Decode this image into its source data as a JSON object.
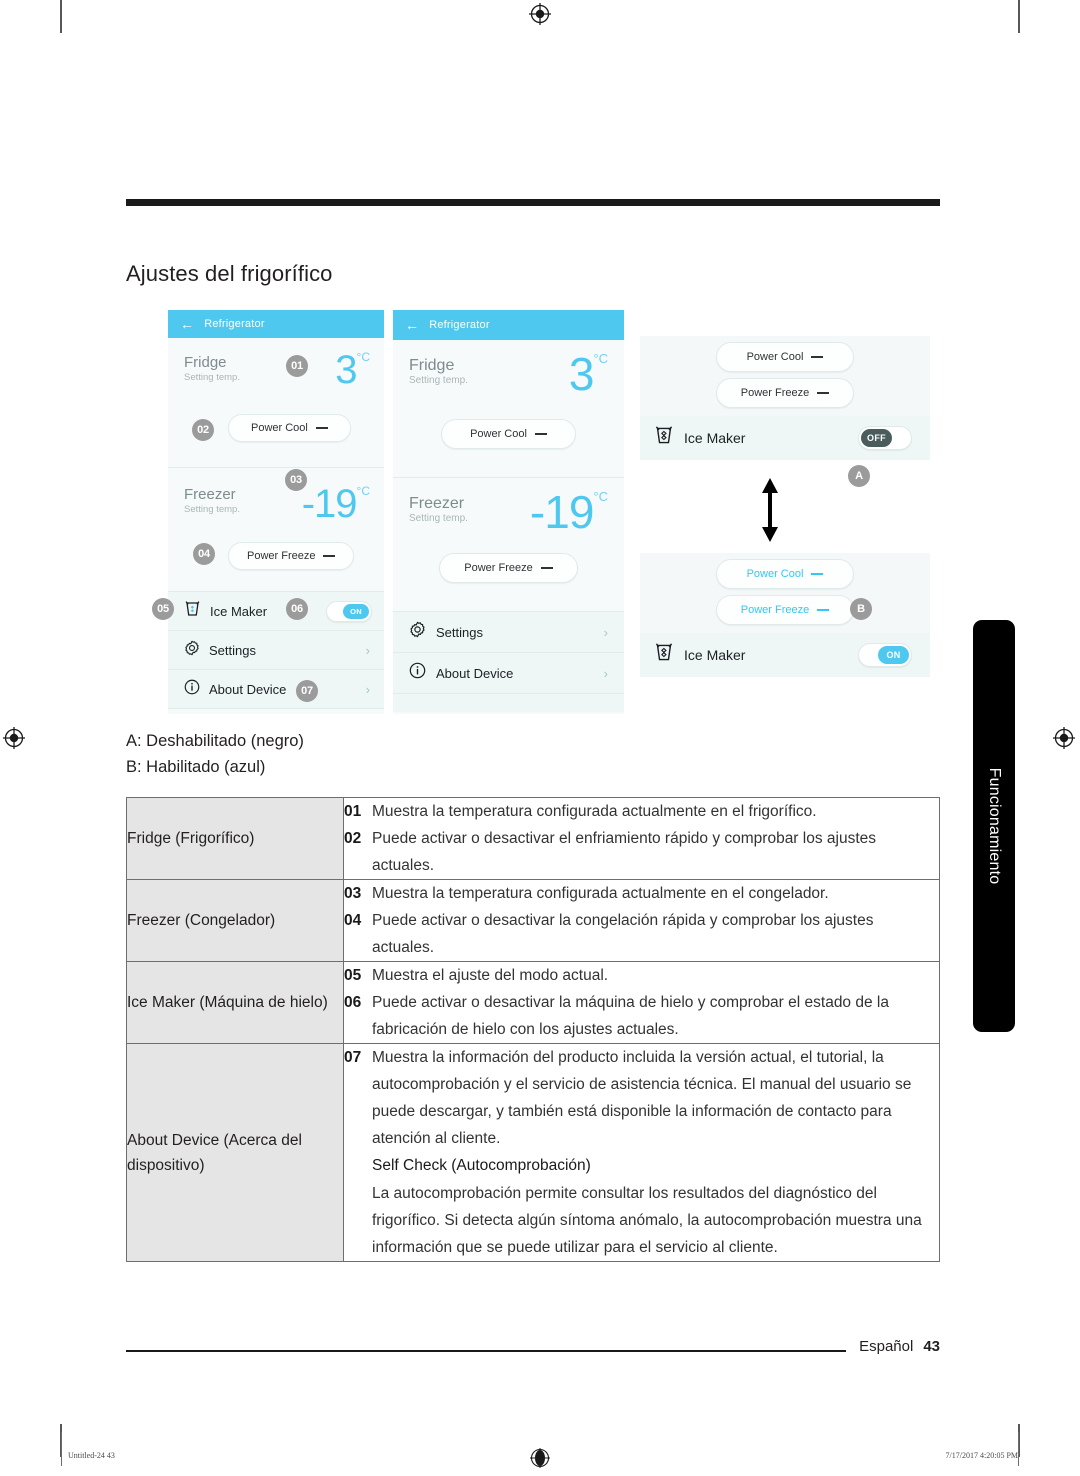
{
  "page": {
    "section_title": "Ajustes del frigorífico",
    "side_tab": "Funcionamiento",
    "footer_language": "Español",
    "footer_page": "43",
    "print_file": "Untitled-24   43",
    "print_timestamp": "7/17/2017   4:20:05 PM"
  },
  "legend": {
    "line_a": "A: Deshabilitado (negro)",
    "line_b": "B: Habilitado (azul)"
  },
  "colors": {
    "accent_blue": "#4fc8f0",
    "toggle_off": "#4b5c5c",
    "badge_gray": "#9b9b9b",
    "key_cell_bg": "#e5e5e5"
  },
  "screen1": {
    "titlebar": "Refrigerator",
    "back_icon": "back-arrow-icon",
    "fridge": {
      "label": "Fridge",
      "sublabel": "Setting temp.",
      "value": "3",
      "unit": "°C",
      "badge_value": "01",
      "button": {
        "label": "Power Cool",
        "badge": "02",
        "state": "off"
      }
    },
    "freezer": {
      "label": "Freezer",
      "sublabel": "Setting temp.",
      "value": "-19",
      "unit": "°C",
      "badge_value": "03",
      "button": {
        "label": "Power Freeze",
        "badge": "04",
        "state": "off"
      }
    },
    "ice_maker": {
      "label": "Ice Maker",
      "icon": "ice-maker-icon",
      "badge_left": "05",
      "badge_right": "06",
      "toggle": "ON"
    },
    "settings": {
      "label": "Settings",
      "icon": "gear-icon",
      "chevron": "›"
    },
    "about": {
      "label": "About Device",
      "icon": "info-icon",
      "badge": "07",
      "chevron": "›"
    }
  },
  "screen2": {
    "titlebar": "Refrigerator",
    "back_icon": "back-arrow-icon",
    "fridge": {
      "label": "Fridge",
      "sublabel": "Setting temp.",
      "value": "3",
      "unit": "°C",
      "button": {
        "label": "Power Cool",
        "state": "off"
      }
    },
    "freezer": {
      "label": "Freezer",
      "sublabel": "Setting temp.",
      "value": "-19",
      "unit": "°C",
      "button": {
        "label": "Power Freeze",
        "state": "off"
      }
    },
    "settings": {
      "label": "Settings",
      "icon": "gear-icon",
      "chevron": "›"
    },
    "about": {
      "label": "About Device",
      "icon": "info-icon",
      "chevron": "›"
    }
  },
  "detail": {
    "group_a": {
      "badge": "A",
      "power_cool": "Power Cool",
      "power_freeze": "Power Freeze",
      "ice_maker_label": "Ice Maker",
      "ice_maker_icon": "ice-maker-icon",
      "toggle": "OFF"
    },
    "arrow_icon": "up-down-arrow-icon",
    "group_b": {
      "badge": "B",
      "power_cool": "Power Cool",
      "power_freeze": "Power Freeze",
      "ice_maker_label": "Ice Maker",
      "ice_maker_icon": "ice-maker-icon",
      "toggle": "ON"
    }
  },
  "table": {
    "rows": [
      {
        "key": "Fridge (Frigorífico)",
        "items": [
          {
            "num": "01",
            "text": "Muestra la temperatura configurada actualmente en el frigorífico."
          },
          {
            "num": "02",
            "text": "Puede activar o desactivar el enfriamiento rápido y comprobar los ajustes actuales."
          }
        ]
      },
      {
        "key": "Freezer (Congelador)",
        "items": [
          {
            "num": "03",
            "text": "Muestra la temperatura configurada actualmente en el congelador."
          },
          {
            "num": "04",
            "text": "Puede activar o desactivar la congelación rápida y comprobar los ajustes actuales."
          }
        ]
      },
      {
        "key": "Ice Maker (Máquina de hielo)",
        "items": [
          {
            "num": "05",
            "text": "Muestra el ajuste del modo actual."
          },
          {
            "num": "06",
            "text": "Puede activar o desactivar la máquina de hielo y comprobar el estado de la fabricación de hielo con los ajustes actuales."
          }
        ]
      },
      {
        "key": "About Device (Acerca del dispositivo)",
        "items": [
          {
            "num": "07",
            "text": "Muestra la información del producto incluida la versión actual, el tutorial, la autocomprobación y el servicio de asistencia técnica. El manual del usuario se puede descargar, y también está disponible la información de contacto para atención al cliente."
          }
        ],
        "subtitle": "Self Check (Autocomprobación)",
        "paragraph": "La autocomprobación permite consultar los resultados del diagnóstico del frigorífico. Si detecta algún síntoma anómalo, la autocomprobación muestra una información que se puede utilizar para el servicio al cliente."
      }
    ]
  }
}
